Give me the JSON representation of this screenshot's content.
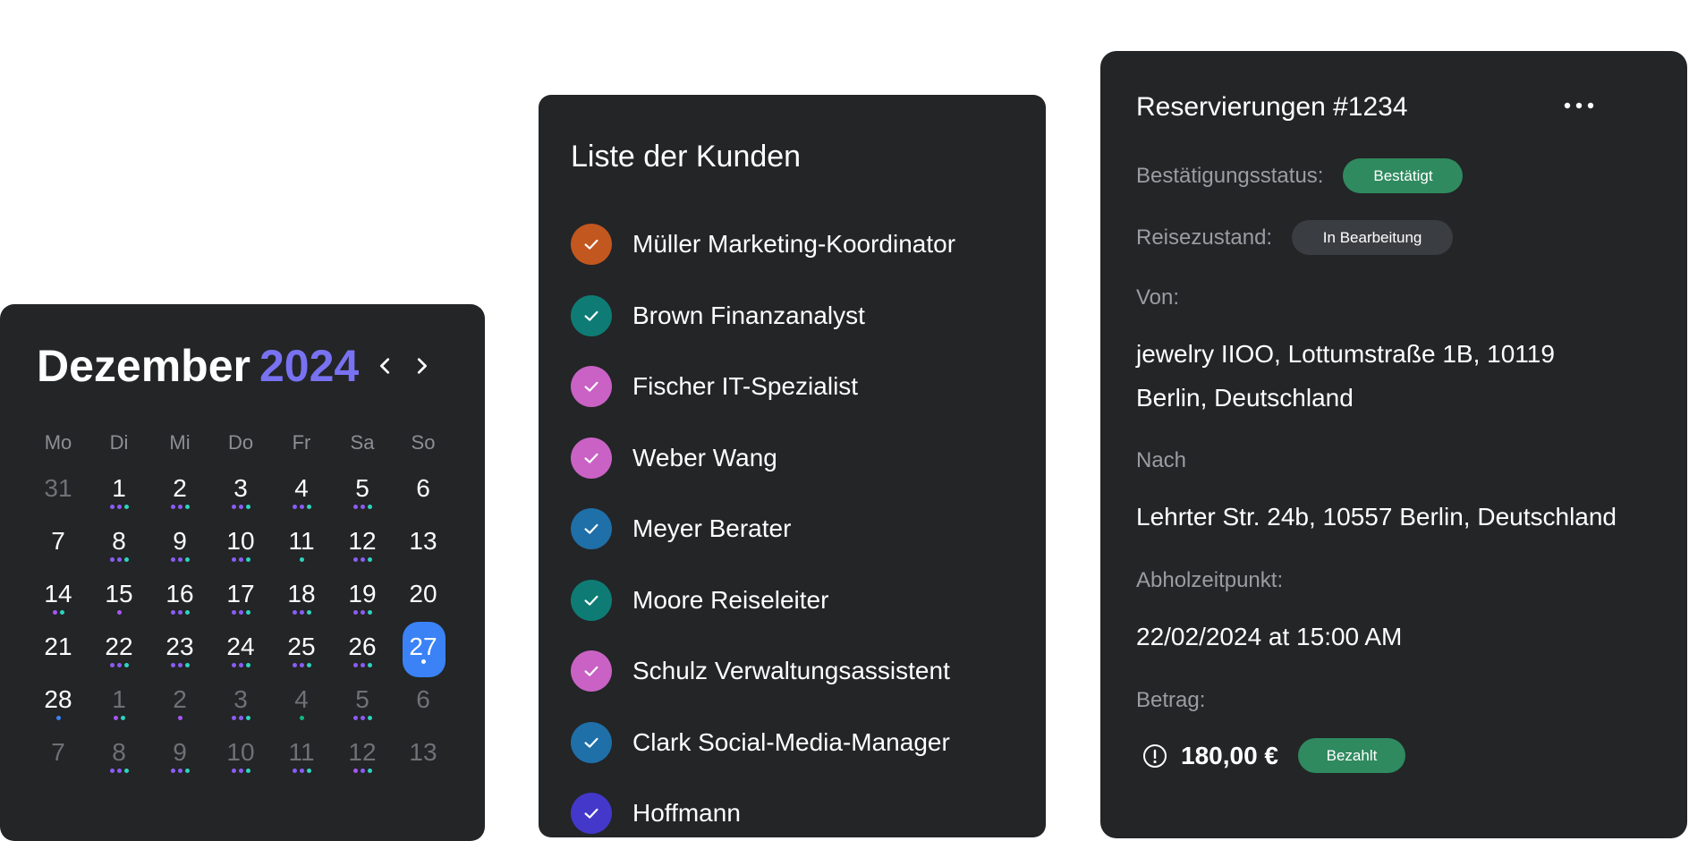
{
  "calendar": {
    "month": "Dezember",
    "year": "2024",
    "year_color": "#7872f2",
    "prev_icon": "chevron-left-icon",
    "next_icon": "chevron-right-icon",
    "weekdays": [
      "Mo",
      "Di",
      "Mi",
      "Do",
      "Fr",
      "Sa",
      "So"
    ],
    "selected_color": "#3b82f6",
    "dot_colors": {
      "p": "#8b5cf6",
      "t": "#2dd4bf",
      "m": "#a855f7",
      "b": "#3b82f6",
      "g": "#10b981",
      "w": "#ffffff"
    },
    "weeks": [
      [
        {
          "n": "31",
          "muted": true,
          "dots": ""
        },
        {
          "n": "1",
          "dots": "ppt"
        },
        {
          "n": "2",
          "dots": "ppt"
        },
        {
          "n": "3",
          "dots": "ppt"
        },
        {
          "n": "4",
          "dots": "ppt"
        },
        {
          "n": "5",
          "dots": "ppt"
        },
        {
          "n": "6",
          "dots": ""
        }
      ],
      [
        {
          "n": "7",
          "dots": ""
        },
        {
          "n": "8",
          "dots": "ppt"
        },
        {
          "n": "9",
          "dots": "ppt"
        },
        {
          "n": "10",
          "dots": "ppt"
        },
        {
          "n": "11",
          "dots": "t"
        },
        {
          "n": "12",
          "dots": "ppt"
        },
        {
          "n": "13",
          "dots": ""
        }
      ],
      [
        {
          "n": "14",
          "dots": "mt"
        },
        {
          "n": "15",
          "dots": "m"
        },
        {
          "n": "16",
          "dots": "ppt"
        },
        {
          "n": "17",
          "dots": "ppt"
        },
        {
          "n": "18",
          "dots": "ppt"
        },
        {
          "n": "19",
          "dots": "ppt"
        },
        {
          "n": "20",
          "dots": ""
        }
      ],
      [
        {
          "n": "21",
          "dots": ""
        },
        {
          "n": "22",
          "dots": "ppt"
        },
        {
          "n": "23",
          "dots": "ppt"
        },
        {
          "n": "24",
          "dots": "ppt"
        },
        {
          "n": "25",
          "dots": "ppt"
        },
        {
          "n": "26",
          "dots": "ppt"
        },
        {
          "n": "27",
          "dots": "w",
          "selected": true
        }
      ],
      [
        {
          "n": "28",
          "dots": "b"
        },
        {
          "n": "1",
          "muted": true,
          "dots": "mt"
        },
        {
          "n": "2",
          "muted": true,
          "dots": "m"
        },
        {
          "n": "3",
          "muted": true,
          "dots": "ppt"
        },
        {
          "n": "4",
          "muted": true,
          "dots": "g"
        },
        {
          "n": "5",
          "muted": true,
          "dots": "ppt"
        },
        {
          "n": "6",
          "muted": true,
          "dots": ""
        }
      ],
      [
        {
          "n": "7",
          "muted": true,
          "dots": ""
        },
        {
          "n": "8",
          "muted": true,
          "dots": "ppt"
        },
        {
          "n": "9",
          "muted": true,
          "dots": "ppt"
        },
        {
          "n": "10",
          "muted": true,
          "dots": "ppt"
        },
        {
          "n": "11",
          "muted": true,
          "dots": "ppt"
        },
        {
          "n": "12",
          "muted": true,
          "dots": "mpt"
        },
        {
          "n": "13",
          "muted": true,
          "dots": ""
        }
      ]
    ]
  },
  "customers": {
    "title": "Liste der Kunden",
    "check_icon": "check-icon",
    "items": [
      {
        "name": "Müller Marketing-Koordinator",
        "color": "#c2571f"
      },
      {
        "name": "Brown Finanzanalyst",
        "color": "#0e7c75"
      },
      {
        "name": "Fischer IT-Spezialist",
        "color": "#c962c4"
      },
      {
        "name": "Weber Wang",
        "color": "#c962c4"
      },
      {
        "name": "Meyer Berater",
        "color": "#1f6fa8"
      },
      {
        "name": "Moore Reiseleiter",
        "color": "#0e7c75"
      },
      {
        "name": "Schulz Verwaltungsassistent",
        "color": "#c962c4"
      },
      {
        "name": "Clark Social-Media-Manager",
        "color": "#1f6fa8"
      },
      {
        "name": "Hoffmann",
        "color": "#4338ca"
      }
    ]
  },
  "reservation": {
    "title": "Reservierungen #1234",
    "more_icon": "more-horizontal-icon",
    "status_label": "Bestätigungsstatus:",
    "status_badge": "Bestätigt",
    "travel_label": "Reisezustand:",
    "travel_badge": "In Bearbeitung",
    "from_label": "Von:",
    "from_value_line1": "jewelry IIOO, Lottumstraße 1B, 10119",
    "from_value_line2": "Berlin, Deutschland",
    "to_label": "Nach",
    "to_value": "Lehrter Str. 24b, 10557 Berlin, Deutschland",
    "pickup_label": "Abholzeitpunkt:",
    "pickup_value": "22/02/2024 at 15:00 AM",
    "amount_label": "Betrag:",
    "amount_icon": "info-circle-icon",
    "amount_value": "180,00 €",
    "paid_badge": "Bezahlt"
  }
}
